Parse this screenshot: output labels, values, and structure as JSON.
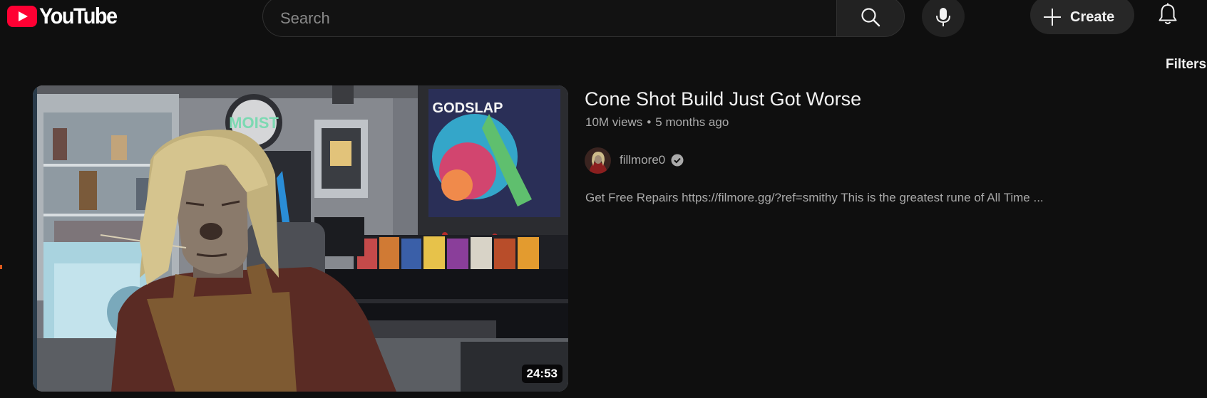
{
  "header": {
    "logo_text": "YouTube",
    "search": {
      "placeholder": "Search",
      "value": ""
    },
    "create_label": "Create",
    "filters_label": "Filters"
  },
  "icons": {
    "logo": "youtube-logo-icon",
    "search": "search-icon",
    "mic": "mic-icon",
    "create": "plus-icon",
    "notifications": "bell-icon",
    "verified": "verified-check-icon"
  },
  "colors": {
    "background": "#0f0f0f",
    "brand_red": "#ff0033",
    "primary_text": "#f1f1f1",
    "secondary_text": "#aaaaaa",
    "chip_bg": "#272727"
  },
  "result": {
    "title": "Cone Shot Build Just Got Worse",
    "views": "10M views",
    "separator": "•",
    "age": "5 months ago",
    "channel": "fillmore0",
    "description": "Get Free Repairs https://filmore.gg/?ref=smithy This is the greatest rune of All Time ...",
    "duration": "24:53",
    "thumbnail_texts": {
      "sign": "MOIST",
      "poster": "GODSLAP"
    }
  }
}
